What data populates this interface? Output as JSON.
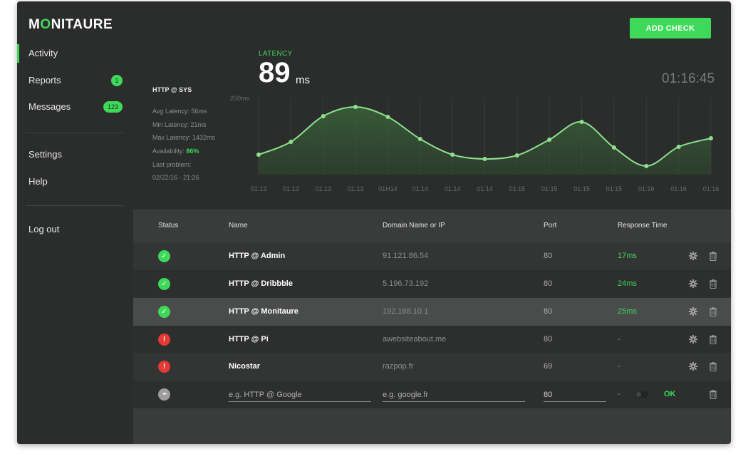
{
  "app": {
    "logo_pre": "M",
    "logo_ring": "O",
    "logo_post": "NITAURE"
  },
  "sidebar": {
    "items": [
      {
        "label": "Activity",
        "badge": ""
      },
      {
        "label": "Reports",
        "badge": "1"
      },
      {
        "label": "Messages",
        "badge": "123"
      },
      {
        "label": "Settings",
        "badge": ""
      },
      {
        "label": "Help",
        "badge": ""
      },
      {
        "label": "Log out",
        "badge": ""
      }
    ]
  },
  "header": {
    "add_label": "ADD CHECK",
    "latency_label": "LATENCY",
    "latency_value": "89",
    "latency_unit": "ms",
    "clock": "01:16:45"
  },
  "service": {
    "title": "HTTP @ SYS",
    "avg": "Avg Latency: 56ms",
    "min": "Min Latency: 21ms",
    "max": "Max Latency: 1432ms",
    "availability_label": "Availability:",
    "availability_value": "86%",
    "last_problem_label": "Last problem:",
    "last_problem_value": "02/22/16 - 21:26"
  },
  "chart_data": {
    "type": "line",
    "ymax_label": "200ms",
    "x": [
      "01:13",
      "01:13",
      "01:13",
      "01:13",
      "01H14",
      "01:14",
      "01:14",
      "01:14",
      "01:15",
      "01:15",
      "01:15",
      "01:15",
      "01:16",
      "01:16",
      "01:16"
    ],
    "values": [
      28,
      46,
      82,
      95,
      81,
      50,
      28,
      22,
      27,
      49,
      74,
      38,
      12,
      39,
      51
    ],
    "ylim": [
      0,
      100
    ],
    "line_color": "#8ee08e",
    "accent": "#3fd95a"
  },
  "table": {
    "headers": {
      "status": "Status",
      "name": "Name",
      "domain": "Domain Name or IP",
      "port": "Port",
      "response": "Response Time"
    },
    "rows": [
      {
        "status": "up",
        "status_glyph": "✓",
        "name": "HTTP @ Admin",
        "domain": "91.121.86.54",
        "port": "80",
        "response": "17ms"
      },
      {
        "status": "up",
        "status_glyph": "✓",
        "name": "HTTP @ Dribbble",
        "domain": "5.196.73.192",
        "port": "80",
        "response": "24ms"
      },
      {
        "status": "up",
        "status_glyph": "✓",
        "name": "HTTP @ Monitaure",
        "domain": "192.168.10.1",
        "port": "80",
        "response": "25ms"
      },
      {
        "status": "down",
        "status_glyph": "!",
        "name": "HTTP @ Pi",
        "domain": "awebsiteabout.me",
        "port": "80",
        "response": "-"
      },
      {
        "status": "down",
        "status_glyph": "!",
        "name": "Nicostar",
        "domain": "razpop.fr",
        "port": "69",
        "response": "-"
      }
    ],
    "new_row": {
      "status_glyph": "•••",
      "name_placeholder": "e.g. HTTP @ Google",
      "domain_placeholder": "e.g. google.fr",
      "port_value": "80",
      "dash": "-",
      "ok_label": "OK"
    }
  },
  "colors": {
    "accent": "#3fd95a",
    "danger": "#e53935",
    "panel": "#2b2c2c",
    "surface": "#3a3b3b"
  }
}
